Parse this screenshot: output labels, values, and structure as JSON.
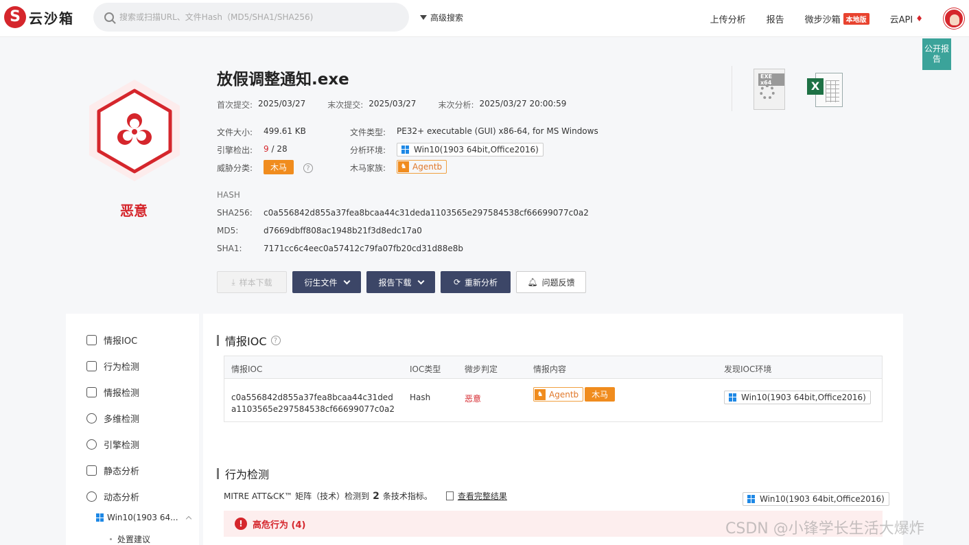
{
  "header": {
    "logo_text": "云沙箱",
    "search_placeholder": "搜索或扫描URL、文件Hash（MD5/SHA1/SHA256)",
    "advanced_search": "高级搜索",
    "nav": {
      "upload": "上传分析",
      "report": "报告",
      "local_sandbox": "微步沙箱",
      "local_badge": "本地版",
      "cloud_api": "云API"
    }
  },
  "public_report": "公开报告",
  "verdict": {
    "label": "恶意",
    "color": "#d5262c"
  },
  "file": {
    "name": "放假调整通知.exe",
    "first_submit_label": "首次提交:",
    "first_submit": "2025/03/27",
    "last_submit_label": "末次提交:",
    "last_submit": "2025/03/27",
    "last_analysis_label": "末次分析:",
    "last_analysis": "2025/03/27 20:00:59",
    "size_label": "文件大小:",
    "size": "499.61 KB",
    "type_label": "文件类型:",
    "type": "PE32+ executable (GUI) x86-64, for MS Windows",
    "engines_label": "引擎检出:",
    "engines_detected": "9",
    "engines_sep": "/",
    "engines_total": "28",
    "env_label": "分析环境:",
    "env": "Win10(1903 64bit,Office2016)",
    "threat_label": "威胁分类:",
    "threat": "木马",
    "family_label": "木马家族:",
    "family": "Agentb"
  },
  "hash": {
    "title": "HASH",
    "sha256_label": "SHA256:",
    "sha256": "c0a556842d855a37fea8bcaa44c31deda1103565e297584538cf66699077c0a2",
    "md5_label": "MD5:",
    "md5": "d7669dbff808ac1948b21f3d8edc17a0",
    "sha1_label": "SHA1:",
    "sha1": "7171cc6c4eec0a57412c79fa07fb20cd31d88e8b"
  },
  "actions": {
    "download": "样本下载",
    "derived": "衍生文件",
    "report_download": "报告下载",
    "reanalyze": "重新分析",
    "feedback": "问题反馈"
  },
  "file_icons": {
    "exe_label": "EXE x64",
    "xls_label": "X"
  },
  "sidebar": {
    "items": [
      {
        "label": "情报IOC"
      },
      {
        "label": "行为检测"
      },
      {
        "label": "情报检测"
      },
      {
        "label": "多维检测"
      },
      {
        "label": "引擎检测"
      },
      {
        "label": "静态分析"
      },
      {
        "label": "动态分析"
      }
    ],
    "sub_env": "Win10(1903 64...",
    "sub_sub": "处置建议"
  },
  "ioc": {
    "title": "情报IOC",
    "headers": [
      "情报IOC",
      "IOC类型",
      "微步判定",
      "情报内容",
      "发现IOC环境"
    ],
    "row": {
      "ioc": "c0a556842d855a37fea8bcaa44c31deda1103565e297584538cf66699077c0a2",
      "type": "Hash",
      "verdict": "恶意",
      "tag_family": "Agentb",
      "tag_threat": "木马",
      "env": "Win10(1903 64bit,Office2016)"
    }
  },
  "behavior": {
    "title": "行为检测",
    "mitre_prefix": "MITRE ATT&CK™ 矩阵（技术）检测到",
    "count": "2",
    "mitre_suffix": "条技术指标。",
    "view_full": "查看完整结果",
    "env": "Win10(1903 64bit,Office2016)",
    "alert": "高危行为 (4)"
  },
  "watermark": "CSDN @小锋学长生活大爆炸"
}
